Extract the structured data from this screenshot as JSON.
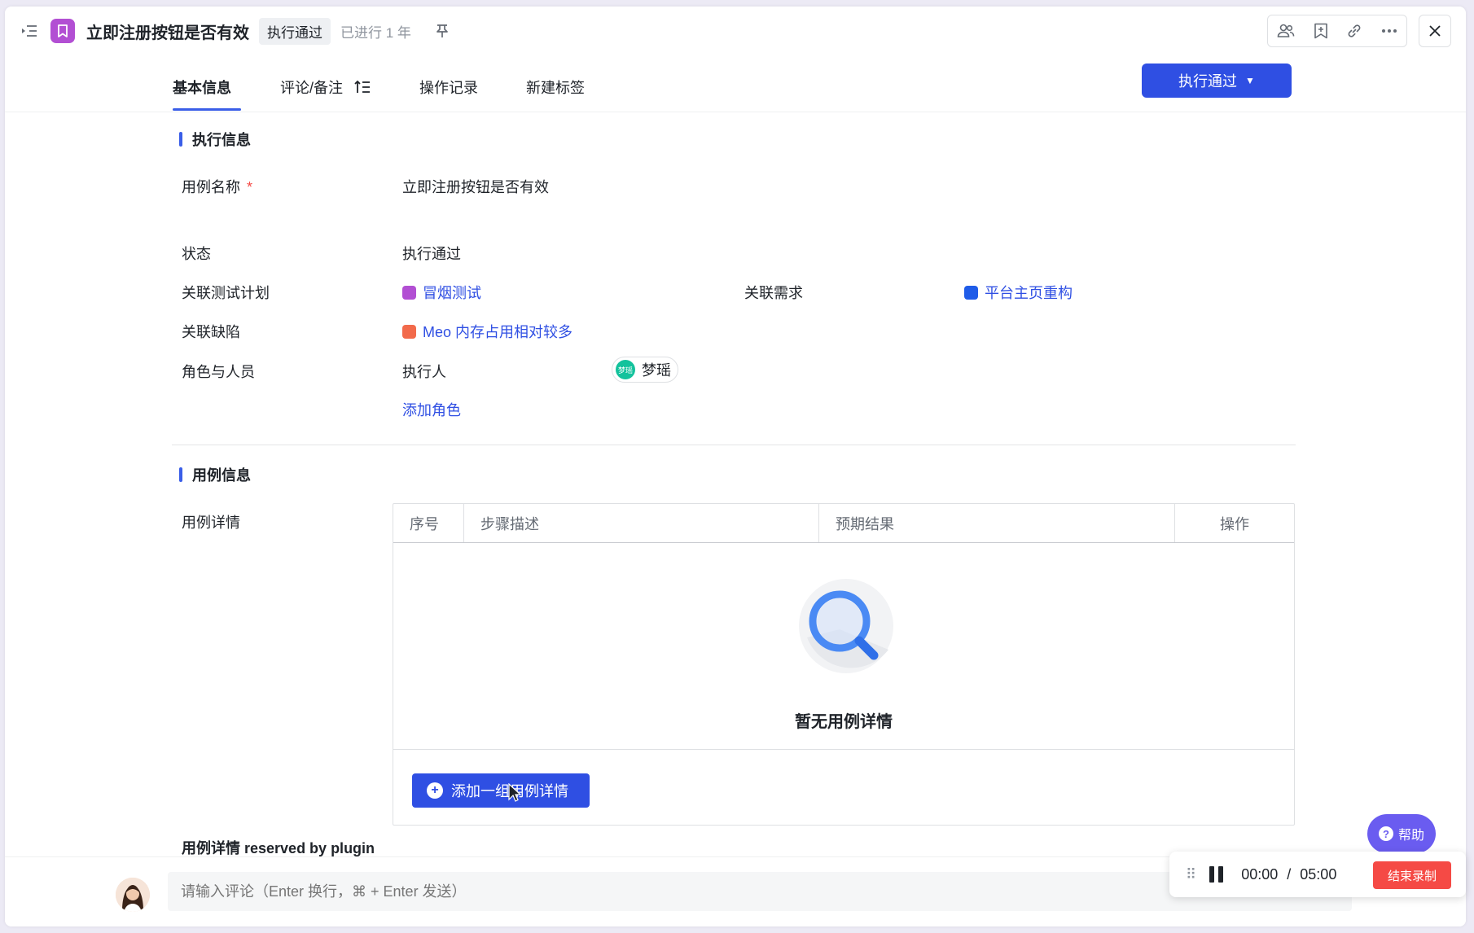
{
  "header": {
    "title": "立即注册按钮是否有效",
    "status": "执行通过",
    "elapsed": "已进行 1 年"
  },
  "tabs": [
    {
      "label": "基本信息"
    },
    {
      "label": "评论/备注"
    },
    {
      "label": "操作记录"
    },
    {
      "label": "新建标签"
    }
  ],
  "exec_button": {
    "label": "执行通过"
  },
  "exec_info": {
    "section_title": "执行信息",
    "case_name_label": "用例名称",
    "required_mark": "*",
    "case_name_value": "立即注册按钮是否有效",
    "status_label": "状态",
    "status_value": "执行通过",
    "test_plan_label": "关联测试计划",
    "test_plan_value": "冒烟测试",
    "requirement_label": "关联需求",
    "requirement_value": "平台主页重构",
    "defect_label": "关联缺陷",
    "defect_value": "Meo 内存占用相对较多",
    "roles_label": "角色与人员",
    "executor_label": "执行人",
    "executor_avatar_text": "梦瑶",
    "executor_name": "梦瑶",
    "add_role": "添加角色"
  },
  "case_info": {
    "section_title": "用例信息",
    "details_label": "用例详情",
    "columns": [
      "序号",
      "步骤描述",
      "预期结果",
      "操作"
    ],
    "empty_text": "暂无用例详情",
    "add_button": "添加一组用例详情",
    "plugin_label": "用例详情 reserved by plugin"
  },
  "comment": {
    "placeholder": "请输入评论（Enter 换行，⌘ + Enter 发送）"
  },
  "help": {
    "label": "帮助",
    "glyph": "?"
  },
  "recorder": {
    "handle": "⠿",
    "current": "00:00",
    "separator": "/",
    "total": "05:00",
    "stop_label": "结束录制"
  },
  "colors": {
    "accent": "#2f4fe3",
    "type_icon": "#b24fd3",
    "plan_square": "#b24fd3",
    "requirement_square": "#1f5ce8",
    "defect_square": "#f26a4b",
    "stop_record": "#f54a45",
    "help": "#6a5cf0"
  }
}
